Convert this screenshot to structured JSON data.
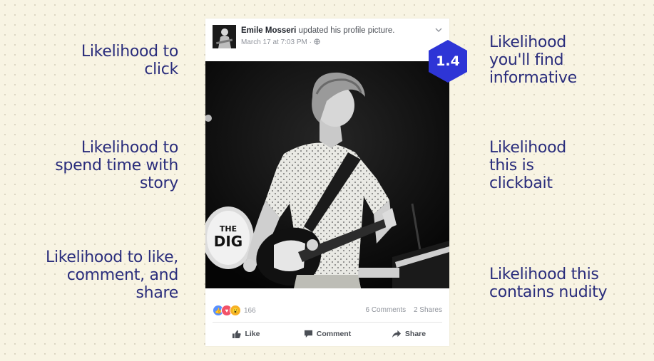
{
  "left_labels": [
    "Likelihood to\nclick",
    "Likelihood to\nspend time with\nstory",
    "Likelihood to like,\ncomment, and\nshare"
  ],
  "right_labels": [
    "Likelihood\nyou'll find\ninformative",
    "Likelihood\nthis is\nclickbait",
    "Likelihood this\ncontains nudity"
  ],
  "post": {
    "author": "Emile Mosseri",
    "action": "updated his profile picture.",
    "date": "March 17 at 7:03 PM",
    "separator": "·",
    "photo_drum_text_1": "THE",
    "photo_drum_text_2": "DIG",
    "reaction_count": "166",
    "comments": "6 Comments",
    "shares": "2 Shares",
    "actions": {
      "like": "Like",
      "comment": "Comment",
      "share": "Share"
    }
  },
  "badge": {
    "value": "1.4",
    "color": "#2e35d6"
  },
  "colors": {
    "label_text": "#2a2d7c",
    "background": "#f8f4e3"
  }
}
